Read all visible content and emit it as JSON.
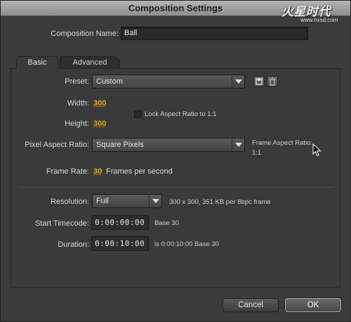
{
  "window": {
    "title": "Composition Settings"
  },
  "watermark": {
    "logo": "火星时代",
    "url": "www.hxsd.com"
  },
  "comp_name": {
    "label": "Composition Name:",
    "value": "Ball"
  },
  "tabs": [
    {
      "label": "Basic",
      "active": true
    },
    {
      "label": "Advanced",
      "active": false
    }
  ],
  "preset": {
    "label": "Preset:",
    "value": "Custom",
    "icons": [
      "save-preset-icon",
      "delete-preset-icon"
    ]
  },
  "width": {
    "label": "Width:",
    "value": "300"
  },
  "height": {
    "label": "Height:",
    "value": "300"
  },
  "lock_aspect": {
    "label": "Lock Aspect Ratio to 1:1",
    "checked": false
  },
  "pixel_aspect": {
    "label": "Pixel Aspect Ratio:",
    "value": "Square Pixels"
  },
  "frame_aspect": {
    "label": "Frame Aspect Ratio:",
    "value": "1:1"
  },
  "frame_rate": {
    "label": "Frame Rate:",
    "value": "30",
    "unit": "Frames per second"
  },
  "resolution": {
    "label": "Resolution:",
    "value": "Full",
    "info": "300 x 300, 351 KB per 8bpc frame"
  },
  "start_timecode": {
    "label": "Start Timecode:",
    "value": "0:00:00:00",
    "info": "Base 30"
  },
  "duration": {
    "label": "Duration:",
    "value": "0:00:10:00",
    "info": "is 0:00:10:00  Base 30"
  },
  "buttons": {
    "cancel": "Cancel",
    "ok": "OK"
  },
  "colors": {
    "accent": "#e8a317",
    "background": "#3b3b3b",
    "titlebar": "#a0a0a0"
  }
}
